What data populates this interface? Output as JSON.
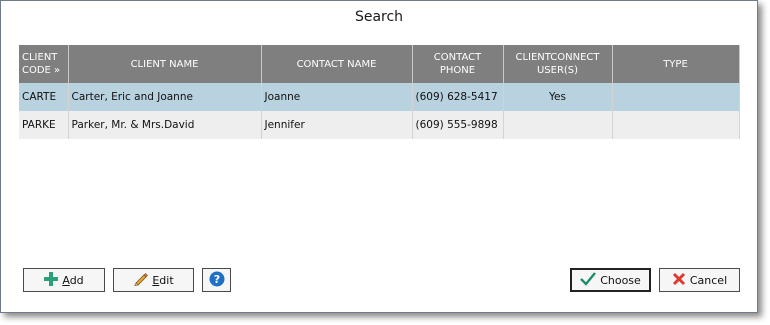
{
  "window": {
    "title": "Search"
  },
  "table": {
    "columns": [
      "CLIENT CODE »",
      "CLIENT NAME",
      "CONTACT NAME",
      "CONTACT PHONE",
      "CLIENTCONNECT USER(S)",
      "TYPE"
    ],
    "rows": [
      {
        "code": "CARTE",
        "client_name": "Carter, Eric and Joanne",
        "contact_name": "Joanne",
        "contact_phone": "(609) 628-5417",
        "clientconnect": "Yes",
        "type": "",
        "selected": true
      },
      {
        "code": "PARKE",
        "client_name": "Parker, Mr. & Mrs.David",
        "contact_name": "Jennifer",
        "contact_phone": "(609) 555-9898",
        "clientconnect": "",
        "type": "",
        "selected": false
      }
    ]
  },
  "buttons": {
    "add": {
      "underline": "A",
      "rest": "dd",
      "icon": "plus-icon"
    },
    "edit": {
      "underline": "E",
      "rest": "dit",
      "icon": "pencil-icon"
    },
    "help": {
      "icon": "help-icon"
    },
    "choose": {
      "label": "Choose",
      "icon": "checkmark-icon"
    },
    "cancel": {
      "label": "Cancel",
      "icon": "cancel-x-icon"
    }
  },
  "colors": {
    "header_bg": "#7f7f7f",
    "selected_row": "#b9d2df",
    "alt_row": "#eeeeee",
    "add_icon": "#2aa17a",
    "help_icon": "#1f6fc4",
    "cancel_icon": "#e03a2f"
  }
}
